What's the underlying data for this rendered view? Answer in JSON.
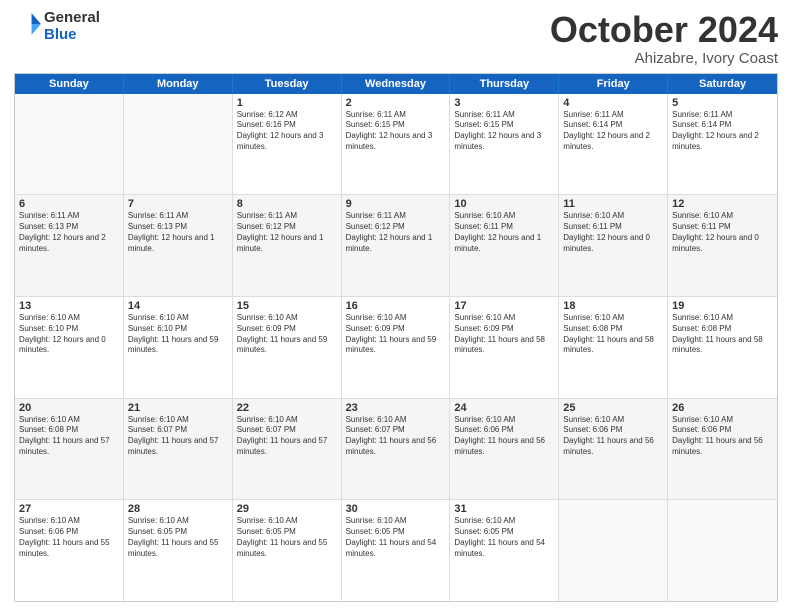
{
  "header": {
    "logo_line1": "General",
    "logo_line2": "Blue",
    "month": "October 2024",
    "location": "Ahizabre, Ivory Coast"
  },
  "days_of_week": [
    "Sunday",
    "Monday",
    "Tuesday",
    "Wednesday",
    "Thursday",
    "Friday",
    "Saturday"
  ],
  "weeks": [
    [
      {
        "num": "",
        "text": "",
        "empty": true
      },
      {
        "num": "",
        "text": "",
        "empty": true
      },
      {
        "num": "1",
        "text": "Sunrise: 6:12 AM\nSunset: 6:16 PM\nDaylight: 12 hours and 3 minutes."
      },
      {
        "num": "2",
        "text": "Sunrise: 6:11 AM\nSunset: 6:15 PM\nDaylight: 12 hours and 3 minutes."
      },
      {
        "num": "3",
        "text": "Sunrise: 6:11 AM\nSunset: 6:15 PM\nDaylight: 12 hours and 3 minutes."
      },
      {
        "num": "4",
        "text": "Sunrise: 6:11 AM\nSunset: 6:14 PM\nDaylight: 12 hours and 2 minutes."
      },
      {
        "num": "5",
        "text": "Sunrise: 6:11 AM\nSunset: 6:14 PM\nDaylight: 12 hours and 2 minutes."
      }
    ],
    [
      {
        "num": "6",
        "text": "Sunrise: 6:11 AM\nSunset: 6:13 PM\nDaylight: 12 hours and 2 minutes."
      },
      {
        "num": "7",
        "text": "Sunrise: 6:11 AM\nSunset: 6:13 PM\nDaylight: 12 hours and 1 minute."
      },
      {
        "num": "8",
        "text": "Sunrise: 6:11 AM\nSunset: 6:12 PM\nDaylight: 12 hours and 1 minute."
      },
      {
        "num": "9",
        "text": "Sunrise: 6:11 AM\nSunset: 6:12 PM\nDaylight: 12 hours and 1 minute."
      },
      {
        "num": "10",
        "text": "Sunrise: 6:10 AM\nSunset: 6:11 PM\nDaylight: 12 hours and 1 minute."
      },
      {
        "num": "11",
        "text": "Sunrise: 6:10 AM\nSunset: 6:11 PM\nDaylight: 12 hours and 0 minutes."
      },
      {
        "num": "12",
        "text": "Sunrise: 6:10 AM\nSunset: 6:11 PM\nDaylight: 12 hours and 0 minutes."
      }
    ],
    [
      {
        "num": "13",
        "text": "Sunrise: 6:10 AM\nSunset: 6:10 PM\nDaylight: 12 hours and 0 minutes."
      },
      {
        "num": "14",
        "text": "Sunrise: 6:10 AM\nSunset: 6:10 PM\nDaylight: 11 hours and 59 minutes."
      },
      {
        "num": "15",
        "text": "Sunrise: 6:10 AM\nSunset: 6:09 PM\nDaylight: 11 hours and 59 minutes."
      },
      {
        "num": "16",
        "text": "Sunrise: 6:10 AM\nSunset: 6:09 PM\nDaylight: 11 hours and 59 minutes."
      },
      {
        "num": "17",
        "text": "Sunrise: 6:10 AM\nSunset: 6:09 PM\nDaylight: 11 hours and 58 minutes."
      },
      {
        "num": "18",
        "text": "Sunrise: 6:10 AM\nSunset: 6:08 PM\nDaylight: 11 hours and 58 minutes."
      },
      {
        "num": "19",
        "text": "Sunrise: 6:10 AM\nSunset: 6:08 PM\nDaylight: 11 hours and 58 minutes."
      }
    ],
    [
      {
        "num": "20",
        "text": "Sunrise: 6:10 AM\nSunset: 6:08 PM\nDaylight: 11 hours and 57 minutes."
      },
      {
        "num": "21",
        "text": "Sunrise: 6:10 AM\nSunset: 6:07 PM\nDaylight: 11 hours and 57 minutes."
      },
      {
        "num": "22",
        "text": "Sunrise: 6:10 AM\nSunset: 6:07 PM\nDaylight: 11 hours and 57 minutes."
      },
      {
        "num": "23",
        "text": "Sunrise: 6:10 AM\nSunset: 6:07 PM\nDaylight: 11 hours and 56 minutes."
      },
      {
        "num": "24",
        "text": "Sunrise: 6:10 AM\nSunset: 6:06 PM\nDaylight: 11 hours and 56 minutes."
      },
      {
        "num": "25",
        "text": "Sunrise: 6:10 AM\nSunset: 6:06 PM\nDaylight: 11 hours and 56 minutes."
      },
      {
        "num": "26",
        "text": "Sunrise: 6:10 AM\nSunset: 6:06 PM\nDaylight: 11 hours and 56 minutes."
      }
    ],
    [
      {
        "num": "27",
        "text": "Sunrise: 6:10 AM\nSunset: 6:06 PM\nDaylight: 11 hours and 55 minutes."
      },
      {
        "num": "28",
        "text": "Sunrise: 6:10 AM\nSunset: 6:05 PM\nDaylight: 11 hours and 55 minutes."
      },
      {
        "num": "29",
        "text": "Sunrise: 6:10 AM\nSunset: 6:05 PM\nDaylight: 11 hours and 55 minutes."
      },
      {
        "num": "30",
        "text": "Sunrise: 6:10 AM\nSunset: 6:05 PM\nDaylight: 11 hours and 54 minutes."
      },
      {
        "num": "31",
        "text": "Sunrise: 6:10 AM\nSunset: 6:05 PM\nDaylight: 11 hours and 54 minutes."
      },
      {
        "num": "",
        "text": "",
        "empty": true
      },
      {
        "num": "",
        "text": "",
        "empty": true
      }
    ]
  ]
}
